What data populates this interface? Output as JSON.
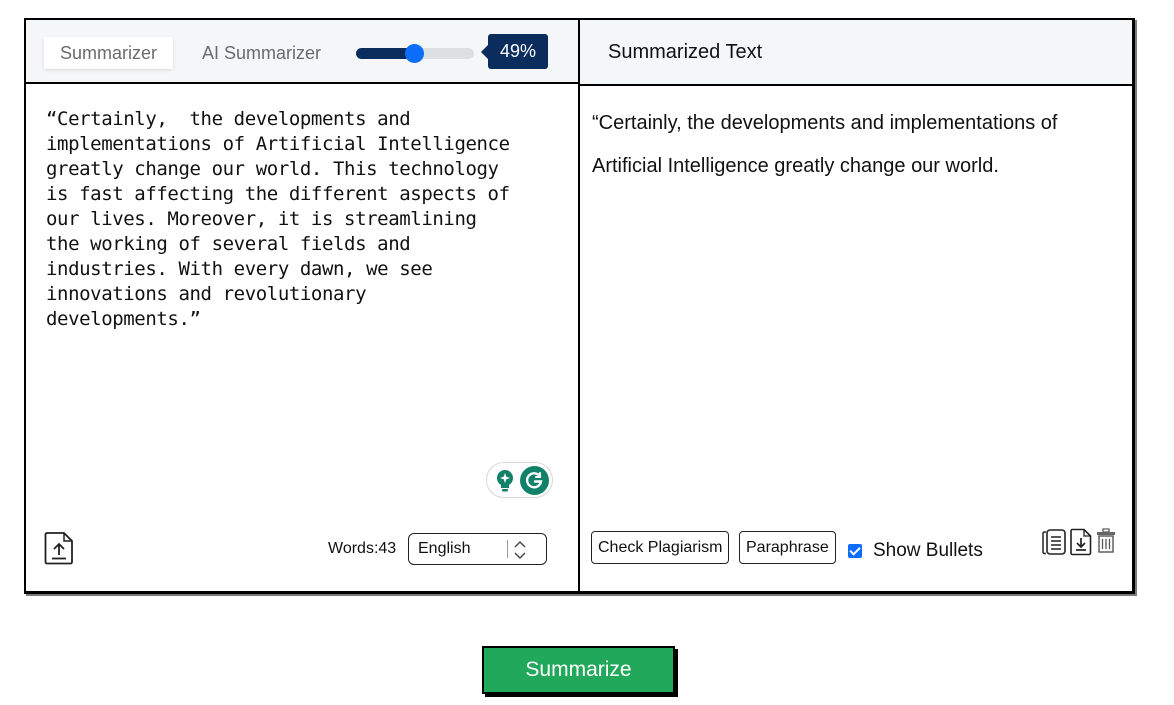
{
  "left_panel": {
    "tabs": [
      {
        "label": "Summarizer",
        "active": true
      },
      {
        "label": "AI Summarizer",
        "active": false
      }
    ],
    "length_slider": {
      "value_percent": 49,
      "label": "49%"
    },
    "input_text": "“Certainly,  the developments and\nimplementations of Artificial Intelligence\ngreatly change our world. This technology\nis fast affecting the different aspects of\nour lives. Moreover, it is streamlining\nthe working of several fields and\nindustries. With every dawn, we see\ninnovations and revolutionary\ndevelopments.”",
    "icons": {
      "upload": "upload-file-icon",
      "grammarly_suggest": "lightbulb-icon",
      "grammarly": "grammarly-icon"
    },
    "word_count_label": "Words:43",
    "language": {
      "selected": "English"
    }
  },
  "right_panel": {
    "title": "Summarized Text",
    "output_text": "“Certainly, the developments and implementations of Artificial Intelligence greatly change our world.",
    "buttons": {
      "check_plagiarism": "Check Plagiarism",
      "paraphrase": "Paraphrase"
    },
    "show_bullets": {
      "label": "Show Bullets",
      "checked": true
    },
    "icons": {
      "copy": "copy-icon",
      "download": "download-icon",
      "delete": "trash-icon"
    }
  },
  "actions": {
    "summarize_label": "Summarize"
  },
  "colors": {
    "slider_fill": "#0b2d5e",
    "slider_thumb": "#0d6efd",
    "summarize_button": "#22a85a",
    "grammarly": "#11816a",
    "header_bg": "#f5f6f8"
  }
}
